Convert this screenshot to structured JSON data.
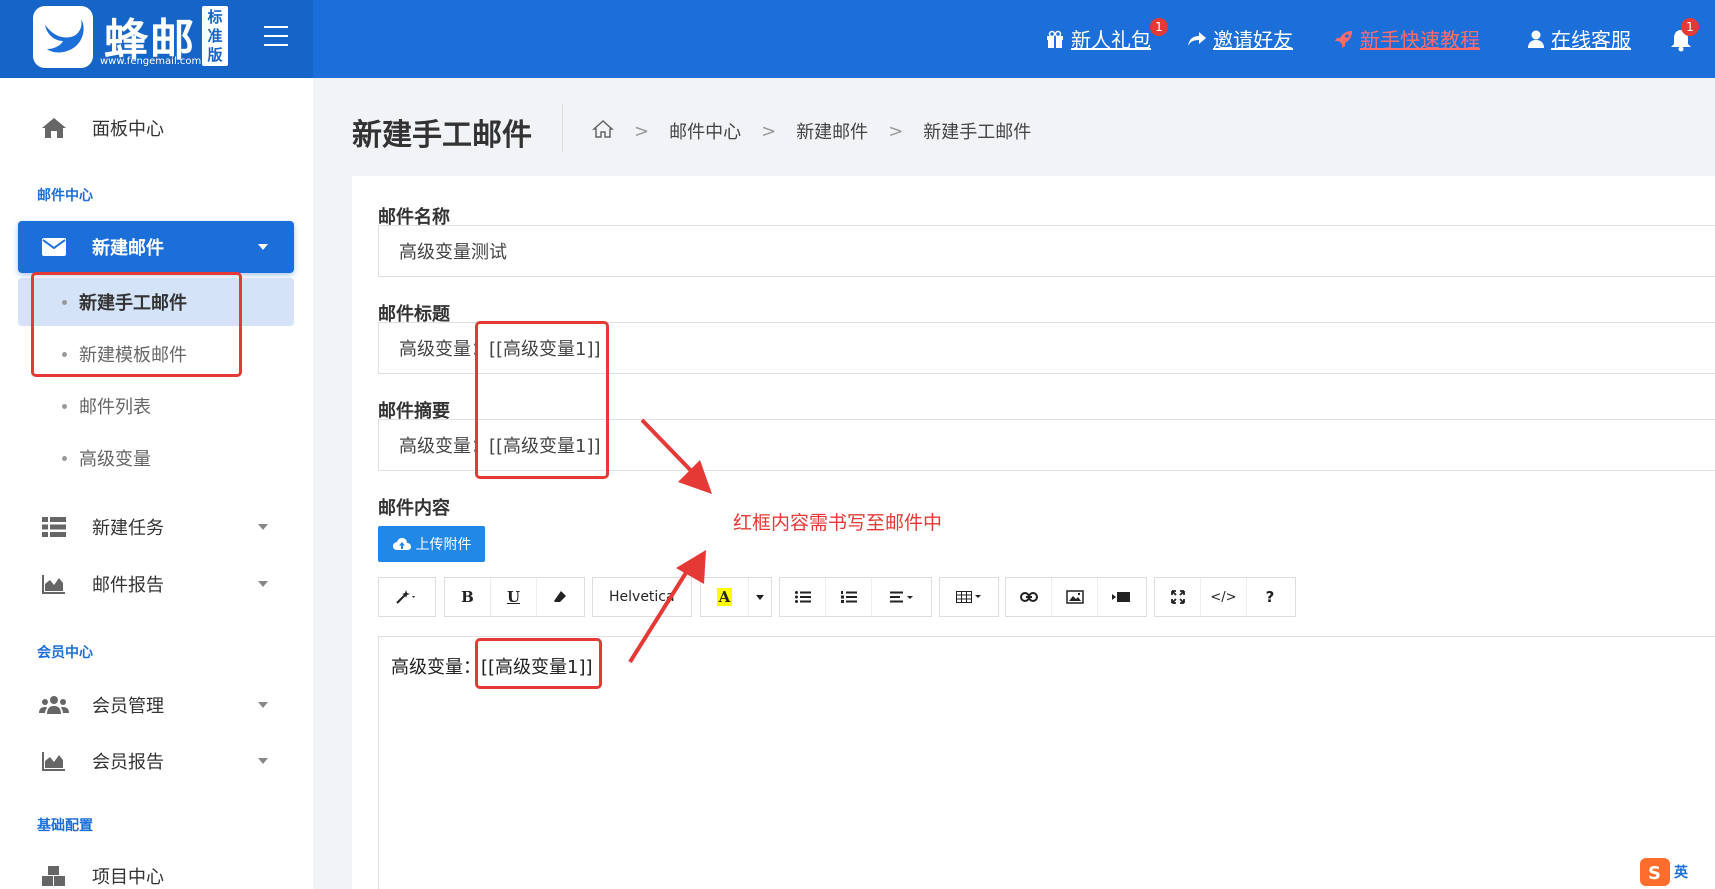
{
  "logo": {
    "title": "蜂邮",
    "url": "www.fengemail.com",
    "edition": [
      "标",
      "准",
      "版"
    ]
  },
  "topnav": {
    "gift": {
      "label": "新人礼包",
      "badge": "1"
    },
    "invite": {
      "label": "邀请好友"
    },
    "tutorial": {
      "label": "新手快速教程"
    },
    "support": {
      "label": "在线客服"
    },
    "notifications": {
      "badge": "1"
    }
  },
  "sidebar": {
    "dashboard": "面板中心",
    "section_mail": "邮件中心",
    "new_mail": "新建邮件",
    "new_mail_sub": [
      "新建手工邮件",
      "新建模板邮件",
      "邮件列表",
      "高级变量"
    ],
    "new_task": "新建任务",
    "mail_report": "邮件报告",
    "section_member": "会员中心",
    "member_manage": "会员管理",
    "member_report": "会员报告",
    "section_config": "基础配置",
    "project_center": "项目中心"
  },
  "page": {
    "title": "新建手工邮件",
    "breadcrumb": [
      "邮件中心",
      "新建邮件",
      "新建手工邮件"
    ]
  },
  "form": {
    "name_label": "邮件名称",
    "name_value": "高级变量测试",
    "subject_label": "邮件标题",
    "subject_value": "高级变量：[[高级变量1]]",
    "summary_label": "邮件摘要",
    "summary_value": "高级变量：[[高级变量1]]",
    "content_label": "邮件内容",
    "upload_label": "上传附件",
    "editor_content": "高级变量：[[高级变量1]]"
  },
  "toolbar": {
    "font": "Helvetica",
    "bold": "B",
    "underline": "U",
    "highlight": "A",
    "code": "</>",
    "help": "?"
  },
  "annotation": {
    "text": "红框内容需书写至邮件中"
  },
  "ime": {
    "lang": "英"
  },
  "colors": {
    "primary": "#1c6fd9",
    "annotation": "#e53935"
  }
}
